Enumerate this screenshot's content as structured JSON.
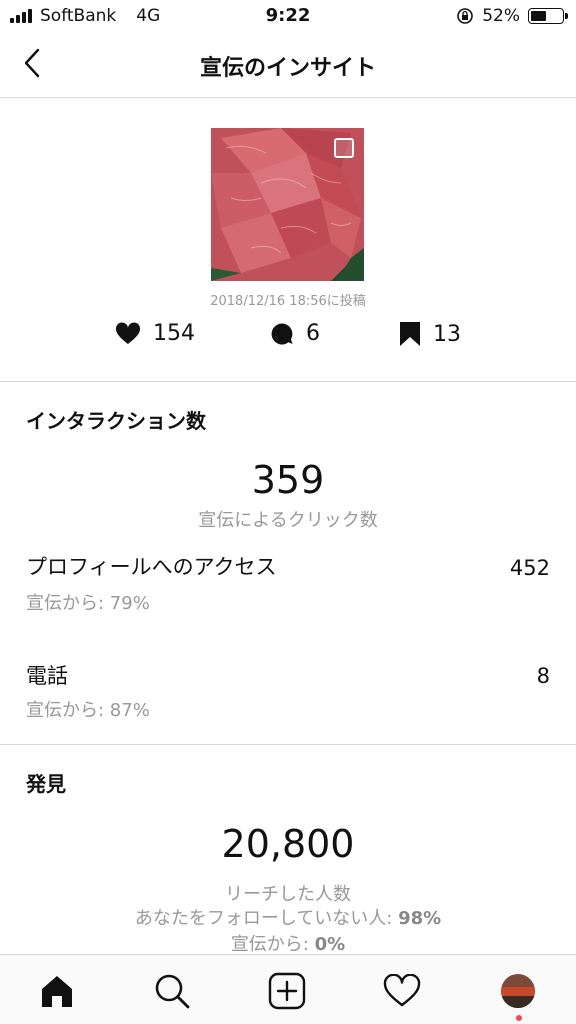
{
  "status": {
    "carrier": "SoftBank",
    "network": "4G",
    "time": "9:22",
    "battery_text": "52%",
    "battery_level": 0.52
  },
  "nav": {
    "title": "宣伝のインサイト"
  },
  "post": {
    "posted_at": "2018/12/16 18:56に投稿",
    "likes": "154",
    "comments": "6",
    "saves": "13"
  },
  "interactions": {
    "title": "インタラクション数",
    "total": "359",
    "total_label": "宣伝によるクリック数",
    "rows": [
      {
        "label": "プロフィールへのアクセス",
        "value": "452",
        "sub": "宣伝から: 79%"
      },
      {
        "label": "電話",
        "value": "8",
        "sub": "宣伝から: 87%"
      }
    ]
  },
  "discovery": {
    "title": "発見",
    "reach": "20,800",
    "reach_label": "リーチした人数",
    "non_follower_prefix": "あなたをフォローしていない人: ",
    "non_follower_value": "98%",
    "from_ad_prefix": "宣伝から: ",
    "from_ad_value": "0%"
  },
  "tabbar": {
    "items": [
      "home-icon",
      "search-icon",
      "add-post-icon",
      "activity-heart-icon",
      "profile-avatar"
    ]
  }
}
